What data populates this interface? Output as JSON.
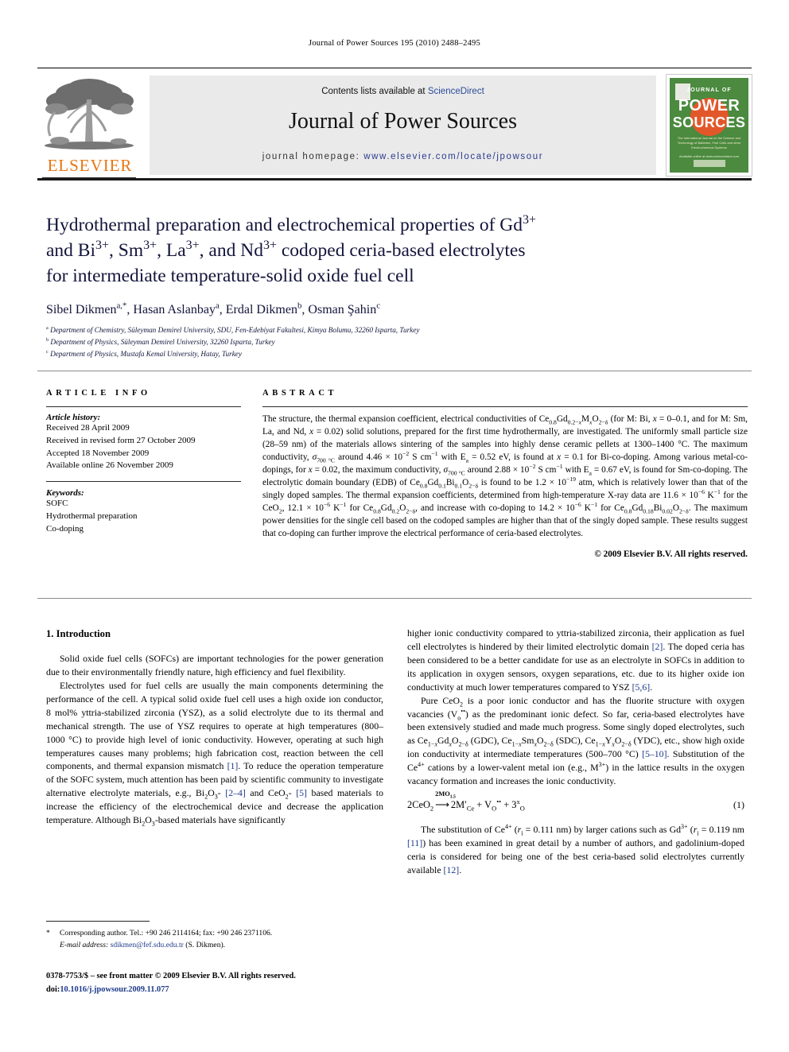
{
  "running_head": "Journal of Power Sources 195 (2010) 2488–2495",
  "masthead": {
    "contents_prefix": "Contents lists available at ",
    "sciencedirect": "ScienceDirect",
    "journal_name": "Journal of Power Sources",
    "homepage_label": "journal homepage:",
    "homepage_url": "www.elsevier.com/locate/jpowsour",
    "publisher_wordmark": "ELSEVIER",
    "publisher_accent": "#e87511",
    "link_color": "#2a4b9b",
    "cover": {
      "journal_of": "JOURNAL OF",
      "power": "POWER",
      "sources": "SOURCES",
      "subtitle": "The International Journal on the Science and Technology of Batteries, Fuel Cells and other Electrochemical Systems",
      "footer": "Available online at www.sciencedirect.com",
      "background": "#4b8a3f",
      "blob_color": "#e2572a"
    }
  },
  "title": {
    "line1_a": "Hydrothermal preparation and electrochemical properties of Gd",
    "line1_sup": "3+",
    "line2_a": "and Bi",
    "line2_sup1": "3+",
    "line2_b": ", Sm",
    "line2_sup2": "3+",
    "line2_c": ", La",
    "line2_sup3": "3+",
    "line2_d": ", and Nd",
    "line2_sup4": "3+",
    "line2_e": " codoped ceria-based electrolytes",
    "line3": "for intermediate temperature-solid oxide fuel cell",
    "color": "#12143a"
  },
  "authors": [
    {
      "name": "Sibel Dikmen",
      "marks": "a,*"
    },
    {
      "name": "Hasan Aslanbay",
      "marks": "a"
    },
    {
      "name": "Erdal Dikmen",
      "marks": "b"
    },
    {
      "name": "Osman Şahin",
      "marks": "c"
    }
  ],
  "affiliations": [
    {
      "mark": "a",
      "text": "Department of Chemistry, Süleyman Demirel University, SDU, Fen-Edebiyat Fakultesi, Kimya Bolumu, 32260 Isparta, Turkey"
    },
    {
      "mark": "b",
      "text": "Department of Physics, Süleyman Demirel University, 32260 Isparta, Turkey"
    },
    {
      "mark": "c",
      "text": "Department of Physics, Mustafa Kemal University, Hatay, Turkey"
    }
  ],
  "article_info": {
    "heading": "ARTICLE INFO",
    "history_label": "Article history:",
    "history": [
      "Received 28 April 2009",
      "Received in revised form 27 October 2009",
      "Accepted 18 November 2009",
      "Available online 26 November 2009"
    ],
    "keywords_label": "Keywords:",
    "keywords": [
      "SOFC",
      "Hydrothermal preparation",
      "Co-doping"
    ]
  },
  "abstract": {
    "heading": "ABSTRACT",
    "copyright": "© 2009 Elsevier B.V. All rights reserved."
  },
  "introduction": {
    "heading": "1. Introduction"
  },
  "equation": {
    "number": "(1)",
    "over_arrow": "2MO",
    "over_arrow_sub": "1.5"
  },
  "footnote": {
    "star": "*",
    "corresponding": "Corresponding author. Tel.: +90 246 2114164; fax: +90 246 2371106.",
    "email_label": "E-mail address:",
    "email": "sdikmen@fef.sdu.edu.tr",
    "email_suffix": "(S. Dikmen)."
  },
  "imprint": {
    "issn_line": "0378-7753/$ – see front matter © 2009 Elsevier B.V. All rights reserved.",
    "doi_label": "doi:",
    "doi": "10.1016/j.jpowsour.2009.11.077"
  }
}
